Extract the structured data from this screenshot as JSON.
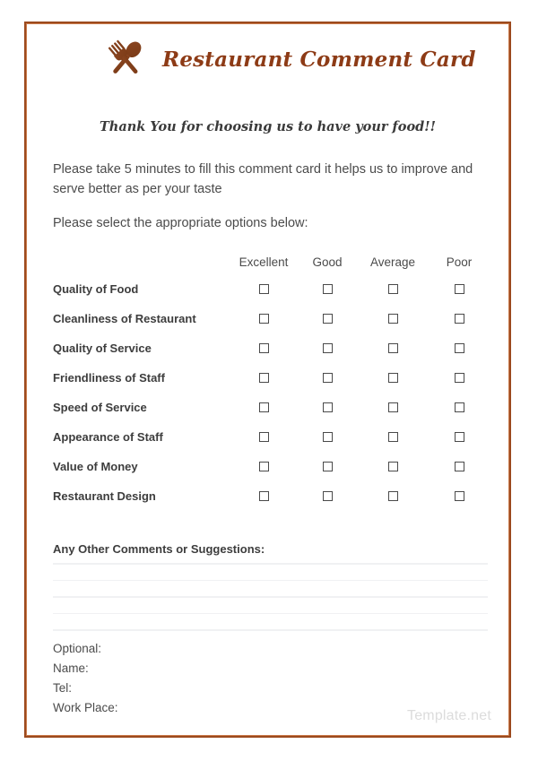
{
  "document": {
    "title": "Restaurant Comment Card",
    "logo_icon": "crossed-spoon-fork-icon",
    "thank_you": "Thank You for choosing us to have your food!!",
    "intro": "Please take 5 minutes to fill this comment card it helps us to improve and serve better as per your taste",
    "select_prompt": "Please select the appropriate options below:",
    "watermark": "Template.net"
  },
  "colors": {
    "border_outer": "#9c4a1e",
    "border_inner": "#c97a4a",
    "title": "#8d3b16",
    "body_text": "#4b4b4b",
    "label_text": "#3d3d3d",
    "rule_line": "#f0f1f3",
    "watermark": "#dcdcdc",
    "checkbox_border": "#4a4a4a"
  },
  "rating_table": {
    "row_header_label": "",
    "columns": [
      "Excellent",
      "Good",
      "Average",
      "Poor"
    ],
    "rows": [
      {
        "label": "Quality of Food",
        "selected": null
      },
      {
        "label": "Cleanliness of Restaurant",
        "selected": null
      },
      {
        "label": "Quality of Service",
        "selected": null
      },
      {
        "label": "Friendliness of Staff",
        "selected": null
      },
      {
        "label": "Speed of Service",
        "selected": null
      },
      {
        "label": "Appearance of Staff",
        "selected": null
      },
      {
        "label": "Value of Money",
        "selected": null
      },
      {
        "label": "Restaurant Design",
        "selected": null
      }
    ]
  },
  "comments": {
    "title": "Any Other Comments or Suggestions:",
    "line_count": 5,
    "value": ""
  },
  "optional_fields": {
    "heading": "Optional:",
    "fields": [
      {
        "label": "Name:",
        "value": ""
      },
      {
        "label": "Tel:",
        "value": ""
      },
      {
        "label": "Work Place:",
        "value": ""
      }
    ]
  }
}
